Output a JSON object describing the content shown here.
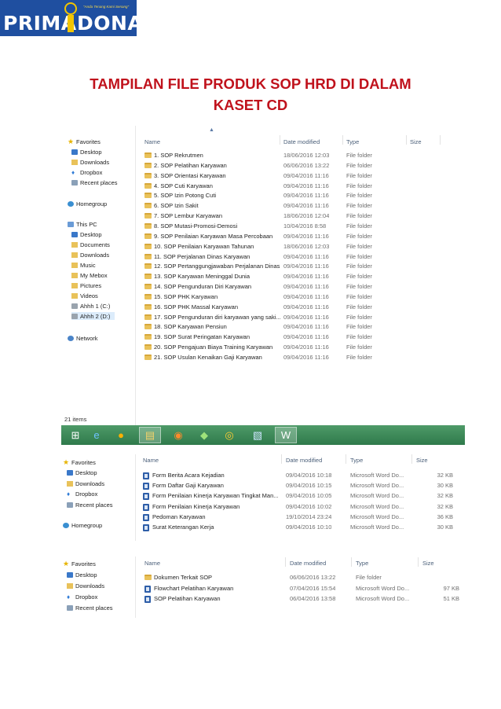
{
  "logo": {
    "word1": "PRIMA",
    "word2": "DONA",
    "tagline": "\"Anda Tenang Kami Senang\""
  },
  "title": {
    "line1": "TAMPILAN FILE PRODUK SOP HRD DI DALAM",
    "line2": "KASET CD"
  },
  "explorer1": {
    "columns": {
      "name": "Name",
      "date": "Date modified",
      "type": "Type",
      "size": "Size"
    },
    "nav": {
      "favorites": "Favorites",
      "fav_items": [
        "Desktop",
        "Downloads",
        "Dropbox",
        "Recent places"
      ],
      "homegroup": "Homegroup",
      "this_pc": "This PC",
      "pc_items": [
        "Desktop",
        "Documents",
        "Downloads",
        "Music",
        "My Mebox",
        "Pictures",
        "Videos",
        "Ahhh 1 (C:)",
        "Ahhh 2 (D:)"
      ],
      "network": "Network"
    },
    "files": [
      {
        "name": "1. SOP Rekrutmen",
        "date": "18/06/2016 12:03",
        "type": "File folder"
      },
      {
        "name": "2. SOP Pelatihan Karyawan",
        "date": "06/06/2016 13:22",
        "type": "File folder"
      },
      {
        "name": "3. SOP Orientasi Karyawan",
        "date": "09/04/2016 11:16",
        "type": "File folder"
      },
      {
        "name": "4. SOP Cuti Karyawan",
        "date": "09/04/2016 11:16",
        "type": "File folder"
      },
      {
        "name": "5. SOP Izin Potong Cuti",
        "date": "09/04/2016 11:16",
        "type": "File folder"
      },
      {
        "name": "6. SOP Izin Sakit",
        "date": "09/04/2016 11:16",
        "type": "File folder"
      },
      {
        "name": "7. SOP Lembur Karyawan",
        "date": "18/06/2016 12:04",
        "type": "File folder"
      },
      {
        "name": "8. SOP Mutasi-Promosi-Demosi",
        "date": "10/04/2016 8:58",
        "type": "File folder"
      },
      {
        "name": "9. SOP Penilaian Karyawan Masa Percobaan",
        "date": "09/04/2016 11:16",
        "type": "File folder"
      },
      {
        "name": "10. SOP Penilaian Karyawan Tahunan",
        "date": "18/06/2016 12:03",
        "type": "File folder"
      },
      {
        "name": "11. SOP Perjalanan Dinas Karyawan",
        "date": "09/04/2016 11:16",
        "type": "File folder"
      },
      {
        "name": "12. SOP Pertanggungjawaban Perjalanan Dinas",
        "date": "09/04/2016 11:16",
        "type": "File folder"
      },
      {
        "name": "13. SOP Karyawan Meninggal Dunia",
        "date": "09/04/2016 11:16",
        "type": "File folder"
      },
      {
        "name": "14. SOP Pengunduran Diri Karyawan",
        "date": "09/04/2016 11:16",
        "type": "File folder"
      },
      {
        "name": "15. SOP PHK Karyawan",
        "date": "09/04/2016 11:16",
        "type": "File folder"
      },
      {
        "name": "16. SOP PHK Massal Karyawan",
        "date": "09/04/2016 11:16",
        "type": "File folder"
      },
      {
        "name": "17. SOP Pengunduran diri karyawan yang saki...",
        "date": "09/04/2016 11:16",
        "type": "File folder"
      },
      {
        "name": "18. SOP Karyawan Pensiun",
        "date": "09/04/2016 11:16",
        "type": "File folder"
      },
      {
        "name": "19. SOP Surat Peringatan Karyawan",
        "date": "09/04/2016 11:16",
        "type": "File folder"
      },
      {
        "name": "20. SOP Pengajuan Biaya Training Karyawan",
        "date": "09/04/2016 11:16",
        "type": "File folder"
      },
      {
        "name": "21. SOP Usulan Kenaikan Gaji Karyawan",
        "date": "09/04/2016 11:16",
        "type": "File folder"
      }
    ],
    "status": "21 items"
  },
  "taskbar": {
    "icons": [
      "windows-start-icon",
      "internet-explorer-icon",
      "media-player-icon",
      "file-explorer-icon",
      "firefox-icon",
      "photos-icon",
      "chrome-icon",
      "notes-icon",
      "word-icon"
    ]
  },
  "explorer2": {
    "columns": {
      "name": "Name",
      "date": "Date modified",
      "type": "Type",
      "size": "Size"
    },
    "nav": {
      "favorites": "Favorites",
      "fav_items": [
        "Desktop",
        "Downloads",
        "Dropbox",
        "Recent places"
      ],
      "homegroup": "Homegroup"
    },
    "files": [
      {
        "name": "Form Berita Acara Kejadian",
        "date": "09/04/2016 10:18",
        "type": "Microsoft Word Do...",
        "size": "32 KB"
      },
      {
        "name": "Form Daftar Gaji Karyawan",
        "date": "09/04/2016 10:15",
        "type": "Microsoft Word Do...",
        "size": "30 KB"
      },
      {
        "name": "Form Penilaian Kinerja Karyawan Tingkat Man...",
        "date": "09/04/2016 10:05",
        "type": "Microsoft Word Do...",
        "size": "32 KB"
      },
      {
        "name": "Form Penilaian Kinerja Karyawan",
        "date": "09/04/2016 10:02",
        "type": "Microsoft Word Do...",
        "size": "32 KB"
      },
      {
        "name": "Pedoman Karyawan",
        "date": "19/10/2014 23:24",
        "type": "Microsoft Word Do...",
        "size": "36 KB"
      },
      {
        "name": "Surat Keterangan Kerja",
        "date": "09/04/2016 10:10",
        "type": "Microsoft Word Do...",
        "size": "30 KB"
      }
    ]
  },
  "explorer3": {
    "columns": {
      "name": "Name",
      "date": "Date modified",
      "type": "Type",
      "size": "Size"
    },
    "nav": {
      "favorites": "Favorites",
      "fav_items": [
        "Desktop",
        "Downloads",
        "Dropbox",
        "Recent places"
      ]
    },
    "files": [
      {
        "name": "Dokumen Terkait SOP",
        "date": "06/06/2016 13:22",
        "type": "File folder",
        "size": ""
      },
      {
        "name": "Flowchart Pelatihan Karyawan",
        "date": "07/04/2016 15:54",
        "type": "Microsoft Word Do...",
        "size": "97 KB"
      },
      {
        "name": "SOP Pelatihan Karyawan",
        "date": "06/04/2016 13:58",
        "type": "Microsoft Word Do...",
        "size": "51 KB"
      }
    ]
  }
}
